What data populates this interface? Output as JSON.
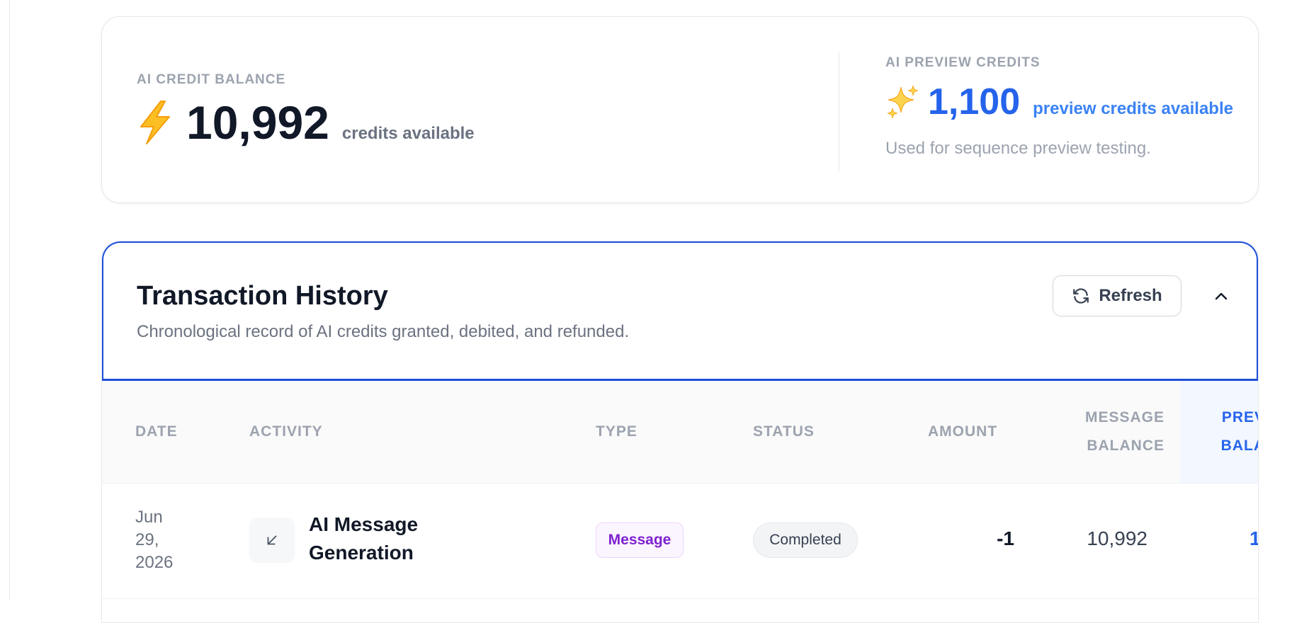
{
  "credits": {
    "label": "AI CREDIT BALANCE",
    "value": "10,992",
    "caption": "credits available"
  },
  "preview": {
    "label": "AI PREVIEW CREDITS",
    "value": "1,100",
    "caption": "preview credits available",
    "note": "Used for sequence preview testing."
  },
  "transactions": {
    "title": "Transaction History",
    "subtitle": "Chronological record of AI credits granted, debited, and refunded.",
    "refresh_label": "Refresh",
    "columns": {
      "date": "DATE",
      "activity": "ACTIVITY",
      "type": "TYPE",
      "status": "STATUS",
      "amount": "AMOUNT",
      "message_balance_1": "MESSAGE",
      "message_balance_2": "BALANCE",
      "preview_balance_1": "PREV",
      "preview_balance_2": "BALA"
    },
    "rows": [
      {
        "date_1": "Jun",
        "date_2": "29,",
        "date_3": "2026",
        "activity_1": "AI Message",
        "activity_2": "Generation",
        "type": "Message",
        "status": "Completed",
        "amount": "-1",
        "message_balance": "10,992",
        "preview_balance": "1,"
      }
    ]
  },
  "colors": {
    "accent": "#2563eb",
    "message_badge": "#7e22ce",
    "bolt": "#f59e0b"
  },
  "icons": {
    "credit": "lightning-bolt-icon",
    "preview": "sparkles-icon",
    "refresh": "refresh-icon",
    "collapse": "chevron-up-icon",
    "activity": "arrow-down-left-icon"
  }
}
